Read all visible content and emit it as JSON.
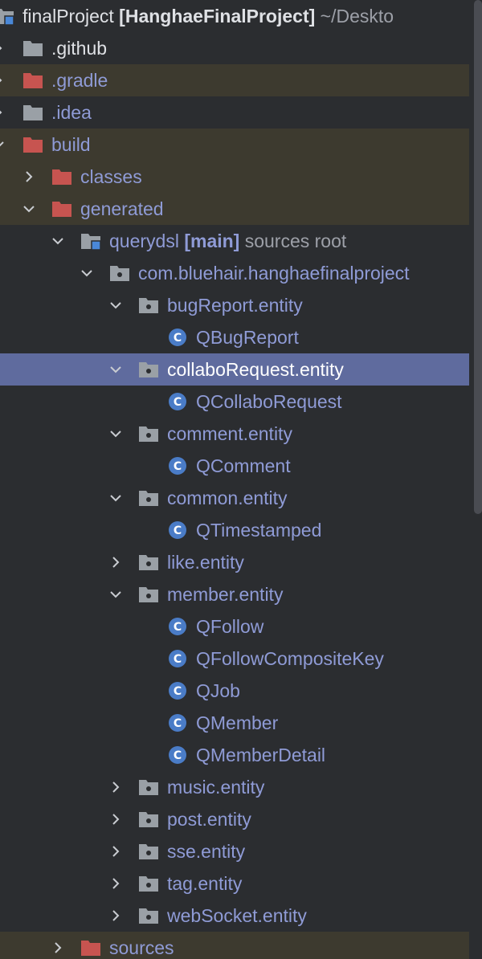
{
  "project": {
    "name": "finalProject",
    "module": "[HanghaeFinalProject]",
    "path": "~/Deskto"
  },
  "rows": {
    "github": ".github",
    "gradle": ".gradle",
    "idea": ".idea",
    "build": "build",
    "classes": "classes",
    "generated": "generated",
    "querydsl": "querydsl",
    "querydsl_tag": "[main]",
    "querydsl_note": "sources root",
    "base_package": "com.bluehair.hanghaefinalproject",
    "bugreport": "bugReport.entity",
    "qbugreport": "QBugReport",
    "collabo": "collaboRequest.entity",
    "qcollabo": "QCollaboRequest",
    "comment": "comment.entity",
    "qcomment": "QComment",
    "common": "common.entity",
    "qtimestamped": "QTimestamped",
    "like": "like.entity",
    "member": "member.entity",
    "qfollow": "QFollow",
    "qfollowkey": "QFollowCompositeKey",
    "qjob": "QJob",
    "qmember": "QMember",
    "qmemberdetail": "QMemberDetail",
    "music": "music.entity",
    "post": "post.entity",
    "sse": "sse.entity",
    "tag": "tag.entity",
    "websocket": "webSocket.entity",
    "sources": "sources"
  },
  "class_icon_letter": "C",
  "colors": {
    "background": "#2b2d30",
    "excluded_bg": "#3d3a2f",
    "selected_bg": "#5f6b9e",
    "excluded_folder": "#c75450",
    "folder": "#9aa0a6",
    "class_icon": "#4a7cc7",
    "package_text": "#8f9bd6"
  }
}
